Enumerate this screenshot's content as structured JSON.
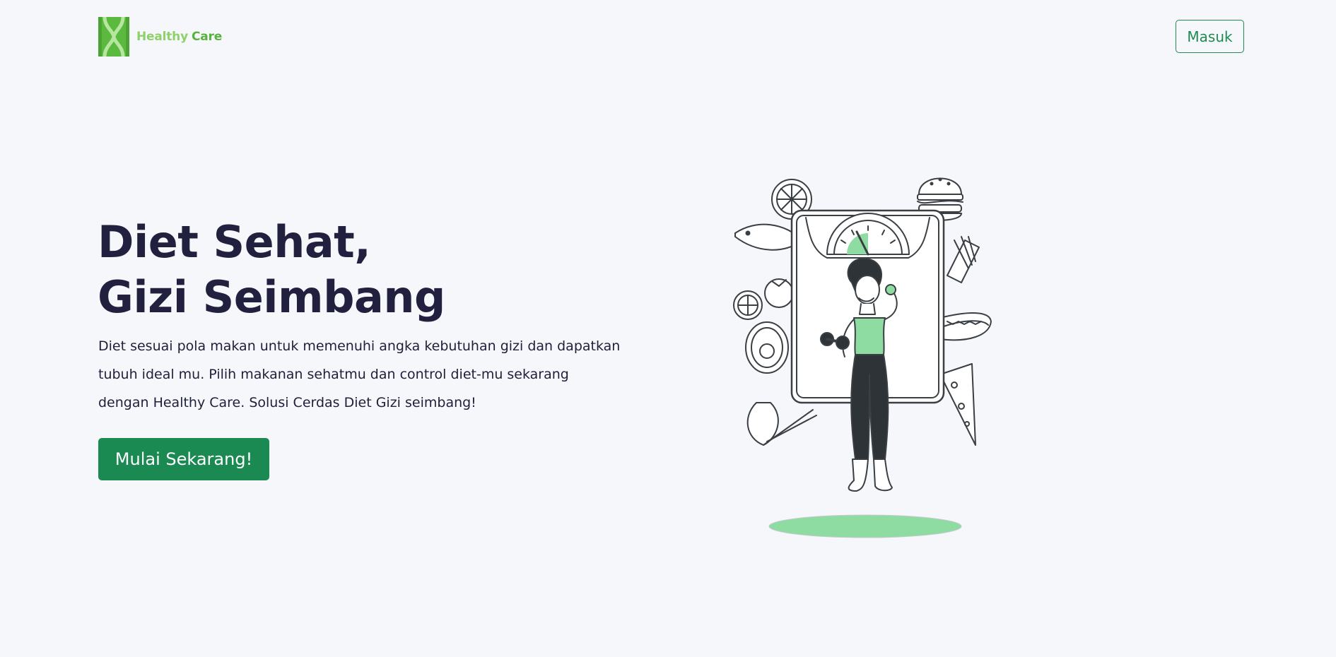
{
  "brand": {
    "name_part1": "Healthy",
    "name_part2": "Care",
    "logo_icon": "healthy-care-logo-icon"
  },
  "nav": {
    "login_label": "Masuk"
  },
  "hero": {
    "title_line1": "Diet Sehat,",
    "title_line2": "Gizi Seimbang",
    "description_lines": [
      "Diet sesuai pola makan untuk memenuhi angka kebutuhan gizi dan dapatkan",
      "tubuh ideal mu. Pilih makanan sehatmu dan control diet-mu sekarang",
      "dengan Healthy Care. Solusi Cerdas Diet Gizi seimbang!"
    ],
    "cta_label": "Mulai Sekarang!",
    "illustration_icon": "woman-on-scale-with-food-illustration"
  },
  "colors": {
    "background": "#f6f7fb",
    "primary_green": "#1b8a52",
    "logo_green_light": "#8ed16b",
    "logo_green_dark": "#57b33f",
    "heading": "#22203f",
    "illustration_accent": "#8fdca3"
  }
}
